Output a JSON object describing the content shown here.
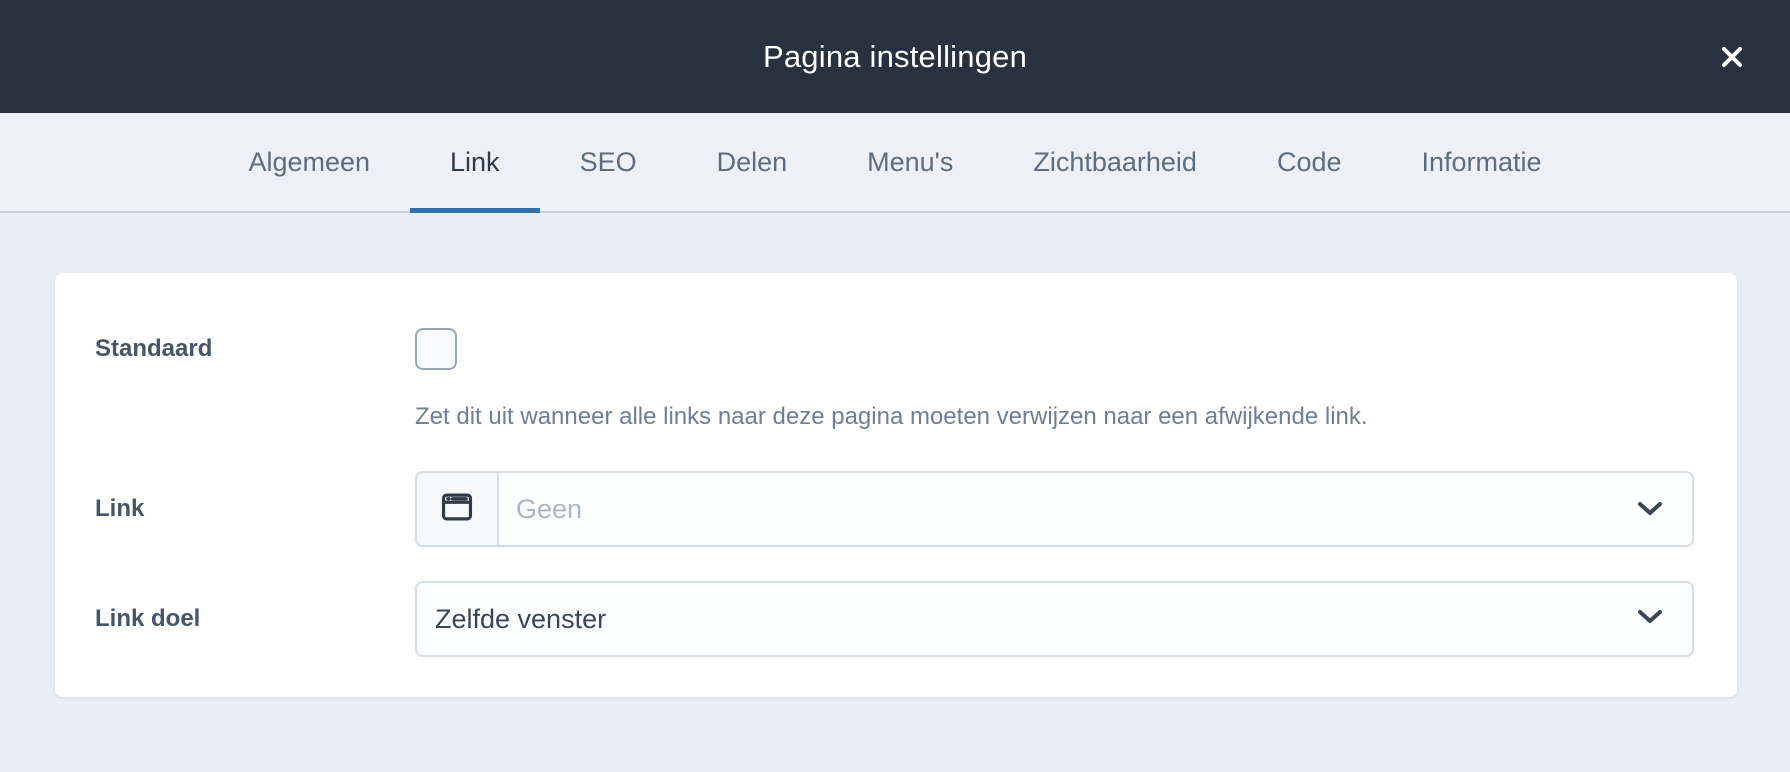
{
  "modal": {
    "title": "Pagina instellingen"
  },
  "tabs": [
    {
      "label": "Algemeen",
      "active": false
    },
    {
      "label": "Link",
      "active": true
    },
    {
      "label": "SEO",
      "active": false
    },
    {
      "label": "Delen",
      "active": false
    },
    {
      "label": "Menu's",
      "active": false
    },
    {
      "label": "Zichtbaarheid",
      "active": false
    },
    {
      "label": "Code",
      "active": false
    },
    {
      "label": "Informatie",
      "active": false
    }
  ],
  "form": {
    "standaard": {
      "label": "Standaard",
      "checked": false,
      "help": "Zet dit uit wanneer alle links naar deze pagina moeten verwijzen naar een afwijkende link."
    },
    "link": {
      "label": "Link",
      "value": "",
      "placeholder": "Geen",
      "icon": "browser-window-icon"
    },
    "link_doel": {
      "label": "Link doel",
      "value": "Zelfde venster"
    }
  },
  "colors": {
    "header_bg": "#28323f",
    "accent_blue": "#2f72ae",
    "tabbar_bg": "#edf1f7",
    "page_bg": "#e9eef6"
  }
}
